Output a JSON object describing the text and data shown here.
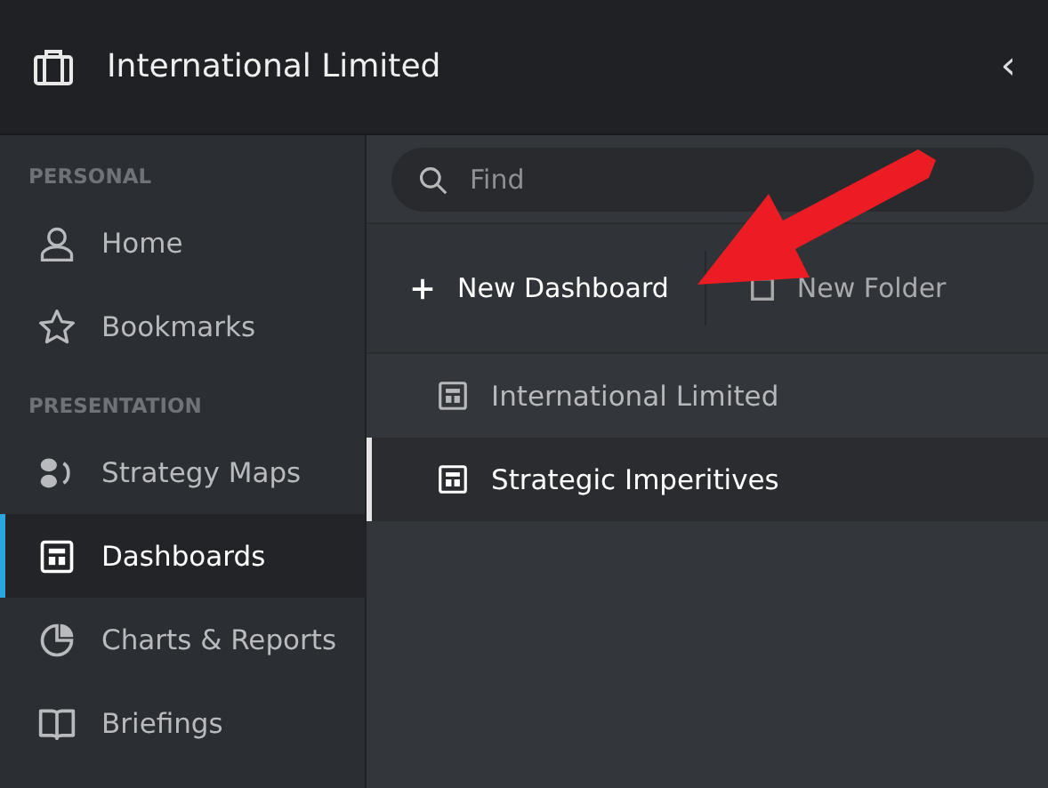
{
  "header": {
    "title": "International Limited",
    "collapse_glyph": "‹"
  },
  "sidebar": {
    "sections": [
      {
        "label": "PERSONAL",
        "items": [
          {
            "label": "Home",
            "kind": "person",
            "selected": false
          },
          {
            "label": "Bookmarks",
            "kind": "star",
            "selected": false
          }
        ]
      },
      {
        "label": "PRESENTATION",
        "items": [
          {
            "label": "Strategy Maps",
            "kind": "map",
            "selected": false
          },
          {
            "label": "Dashboards",
            "kind": "dashboard",
            "selected": true
          },
          {
            "label": "Charts & Reports",
            "kind": "pie",
            "selected": false
          },
          {
            "label": "Briefings",
            "kind": "book",
            "selected": false
          }
        ]
      }
    ]
  },
  "search": {
    "placeholder": "Find"
  },
  "toolbar": [
    {
      "label": "New Dashboard",
      "kind": "plus"
    },
    {
      "label": "New Folder",
      "kind": "folder"
    }
  ],
  "list": [
    {
      "label": "International Limited",
      "selected": false
    },
    {
      "label": "Strategic Imperitives",
      "selected": true
    }
  ]
}
